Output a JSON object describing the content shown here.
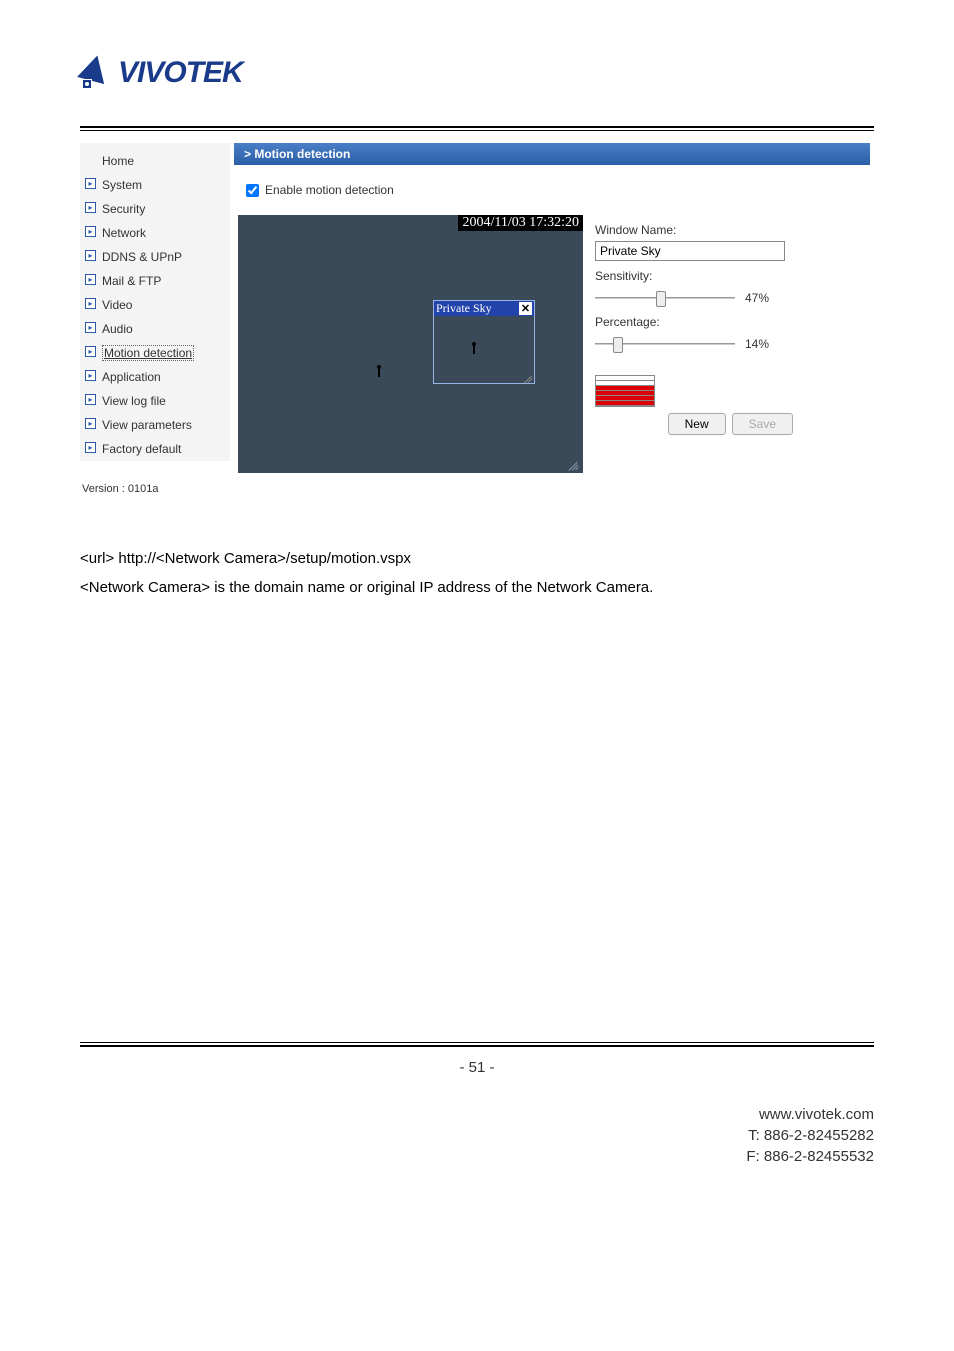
{
  "logo_text": "VIVOTEK",
  "screenshot": {
    "title_bar": "> Motion detection",
    "enable_label": "Enable motion detection",
    "enable_checked": true,
    "nav": {
      "items": [
        {
          "label": "Home",
          "has_arrow": false,
          "selected": false
        },
        {
          "label": "System",
          "has_arrow": true,
          "selected": false
        },
        {
          "label": "Security",
          "has_arrow": true,
          "selected": false
        },
        {
          "label": "Network",
          "has_arrow": true,
          "selected": false
        },
        {
          "label": "DDNS & UPnP",
          "has_arrow": true,
          "selected": false
        },
        {
          "label": "Mail & FTP",
          "has_arrow": true,
          "selected": false
        },
        {
          "label": "Video",
          "has_arrow": true,
          "selected": false
        },
        {
          "label": "Audio",
          "has_arrow": true,
          "selected": false
        },
        {
          "label": "Motion detection",
          "has_arrow": true,
          "selected": true
        },
        {
          "label": "Application",
          "has_arrow": true,
          "selected": false
        },
        {
          "label": "View log file",
          "has_arrow": true,
          "selected": false
        },
        {
          "label": "View parameters",
          "has_arrow": true,
          "selected": false
        },
        {
          "label": "Factory default",
          "has_arrow": true,
          "selected": false
        }
      ],
      "version_label": "Version : 0101a"
    },
    "video": {
      "timestamp": "2004/11/03 17:32:20",
      "window_title": "Private Sky"
    },
    "controls": {
      "window_name_label": "Window Name:",
      "window_name_value": "Private Sky",
      "sensitivity_label": "Sensitivity:",
      "sensitivity_value": "47%",
      "sensitivity_pct": 47,
      "percentage_label": "Percentage:",
      "percentage_value": "14%",
      "percentage_pct": 14,
      "new_button": "New",
      "save_button": "Save"
    }
  },
  "body": {
    "line1": "<url> http://<Network Camera>/setup/motion.vspx",
    "line2": "<Network Camera> is the domain name or original IP address of the Network Camera."
  },
  "footer": {
    "page": "- 51 -",
    "site": "www.vivotek.com",
    "tel": "T: 886-2-82455282",
    "fax": "F: 886-2-82455532"
  }
}
